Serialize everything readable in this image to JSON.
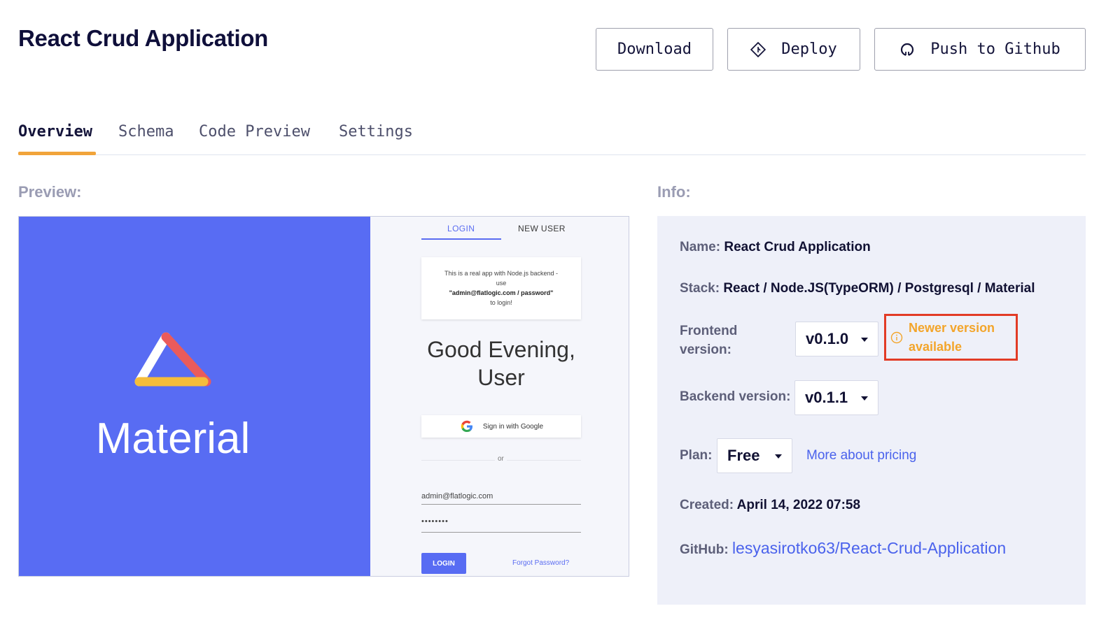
{
  "header": {
    "title": "React Crud Application",
    "buttons": {
      "download": "Download",
      "deploy": "Deploy",
      "github": "Push to Github"
    }
  },
  "tabs": [
    "Overview",
    "Schema",
    "Code Preview",
    "Settings"
  ],
  "active_tab": "Overview",
  "sections": {
    "preview_label": "Preview:",
    "info_label": "Info:"
  },
  "preview": {
    "brand": "Material",
    "tabs": [
      "LOGIN",
      "NEW USER"
    ],
    "note_line1": "This is a real app with Node.js backend -",
    "note_line2": "use",
    "note_line3": "\"admin@flatlogic.com / password\"",
    "note_line4": "to login!",
    "greeting_line1": "Good Evening,",
    "greeting_line2": "User",
    "google_button": "Sign in with Google",
    "or": "or",
    "email_value": "admin@flatlogic.com",
    "password_value": "••••••••",
    "login_button": "LOGIN",
    "forgot": "Forgot Password?"
  },
  "info": {
    "name_label": "Name:",
    "name_value": "React Crud Application",
    "stack_label": "Stack:",
    "stack_value": "React / Node.JS(TypeORM) / Postgresql / Material",
    "frontend_label_line1": "Frontend",
    "frontend_label_line2": "version:",
    "frontend_version": "v0.1.0",
    "newer_line1": "Newer version",
    "newer_line2": "available",
    "backend_label": "Backend version:",
    "backend_version": "v0.1.1",
    "plan_label": "Plan:",
    "plan_value": "Free",
    "pricing_link": "More about pricing",
    "created_label": "Created:",
    "created_value": "April 14, 2022 07:58",
    "github_label": "GitHub:",
    "github_link": "lesyasirotko63/React-Crud-Application"
  },
  "colors": {
    "accent_orange": "#f1a43a",
    "material_blue": "#586cf3",
    "link_blue": "#4a62ec",
    "alert_red": "#e23b26",
    "warning_orange": "#f3a52b"
  }
}
